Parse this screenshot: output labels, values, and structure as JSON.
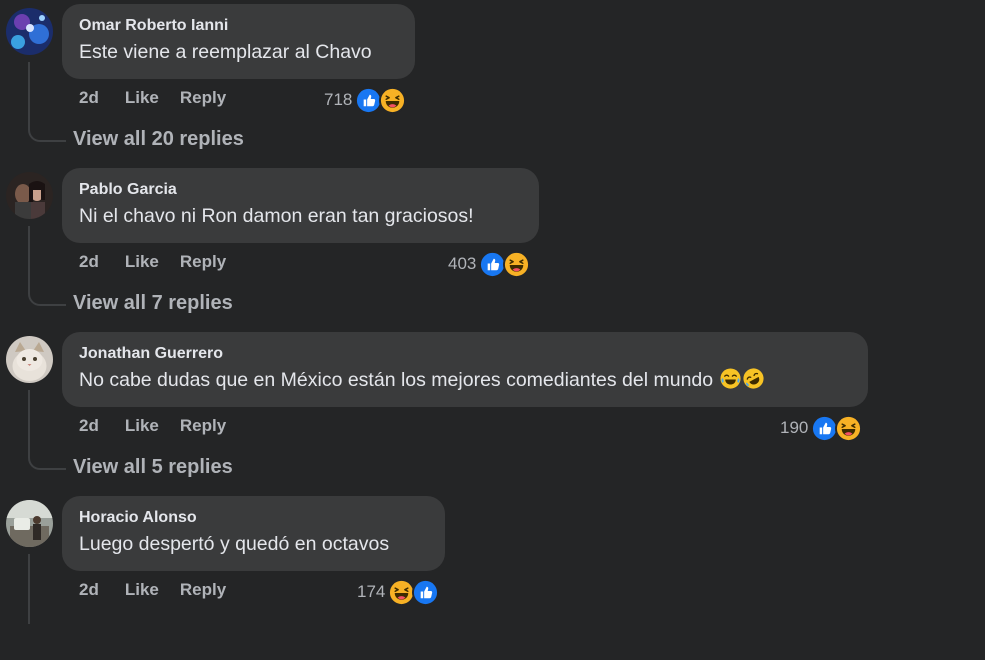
{
  "comments": [
    {
      "author": "Omar Roberto Ianni",
      "text": "Este viene a reemplazar al Chavo",
      "time": "2d",
      "like_label": "Like",
      "reply_label": "Reply",
      "reaction_count": "718",
      "reactions": [
        "like-icon",
        "haha-icon"
      ],
      "view_replies": "View all 20 replies"
    },
    {
      "author": "Pablo Garcia",
      "text": "Ni el chavo ni Ron damon eran tan graciosos!",
      "time": "2d",
      "like_label": "Like",
      "reply_label": "Reply",
      "reaction_count": "403",
      "reactions": [
        "like-icon",
        "haha-icon"
      ],
      "view_replies": "View all 7 replies"
    },
    {
      "author": "Jonathan Guerrero",
      "text": "No cabe dudas que en México están los mejores comediantes del mundo",
      "text_emojis": [
        "face-with-tears-of-joy-icon",
        "rolling-on-floor-laughing-icon"
      ],
      "time": "2d",
      "like_label": "Like",
      "reply_label": "Reply",
      "reaction_count": "190",
      "reactions": [
        "like-icon",
        "haha-icon"
      ],
      "view_replies": "View all 5 replies"
    },
    {
      "author": "Horacio Alonso",
      "text": "Luego despertó y quedó en octavos",
      "time": "2d",
      "like_label": "Like",
      "reply_label": "Reply",
      "reaction_count": "174",
      "reactions": [
        "haha-icon",
        "like-icon"
      ],
      "view_replies": ""
    }
  ],
  "colors": {
    "background": "#242526",
    "bubble": "#3a3b3c",
    "primary_text": "#e4e6eb",
    "secondary_text": "#b0b3b8",
    "like_blue": "#1877f2",
    "haha_yellow": "#f7b125"
  }
}
